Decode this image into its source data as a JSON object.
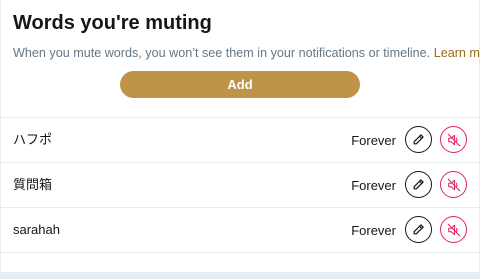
{
  "header": {
    "title": "Words you're muting",
    "description": "When you mute words, you won’t see them in your notifications or timeline. ",
    "learn_more": "Learn more.",
    "add_label": "Add"
  },
  "muted_words": [
    {
      "word": "ハフポ",
      "duration": "Forever"
    },
    {
      "word": "質問箱",
      "duration": "Forever"
    },
    {
      "word": "sarahah",
      "duration": "Forever"
    }
  ],
  "colors": {
    "accent": "#bf9348",
    "link": "#9a6a13",
    "danger": "#e0245e"
  },
  "icons": {
    "edit": "pencil-icon",
    "unmute": "muted-speaker-icon"
  }
}
